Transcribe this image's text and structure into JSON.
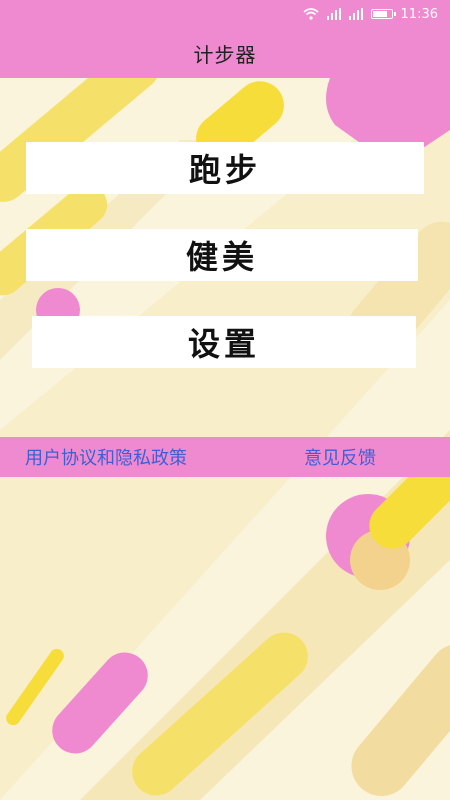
{
  "status_bar": {
    "time": "11:36",
    "icons": [
      "wifi-icon",
      "signal-icon",
      "signal-icon",
      "battery-icon"
    ]
  },
  "app_bar": {
    "title": "计步器"
  },
  "menu": {
    "run": "跑步",
    "fitness": "健美",
    "settings": "设置"
  },
  "links": {
    "privacy": "用户协议和隐私政策",
    "feedback": "意见反馈"
  },
  "colors": {
    "accent_pink": "#f08ad0",
    "background_cream": "#fbf4dc",
    "link_blue": "#3c5fd6",
    "deco_yellow": "#f5e16a",
    "deco_gold": "#f6dd3a",
    "deco_pink": "#f08ad0"
  }
}
